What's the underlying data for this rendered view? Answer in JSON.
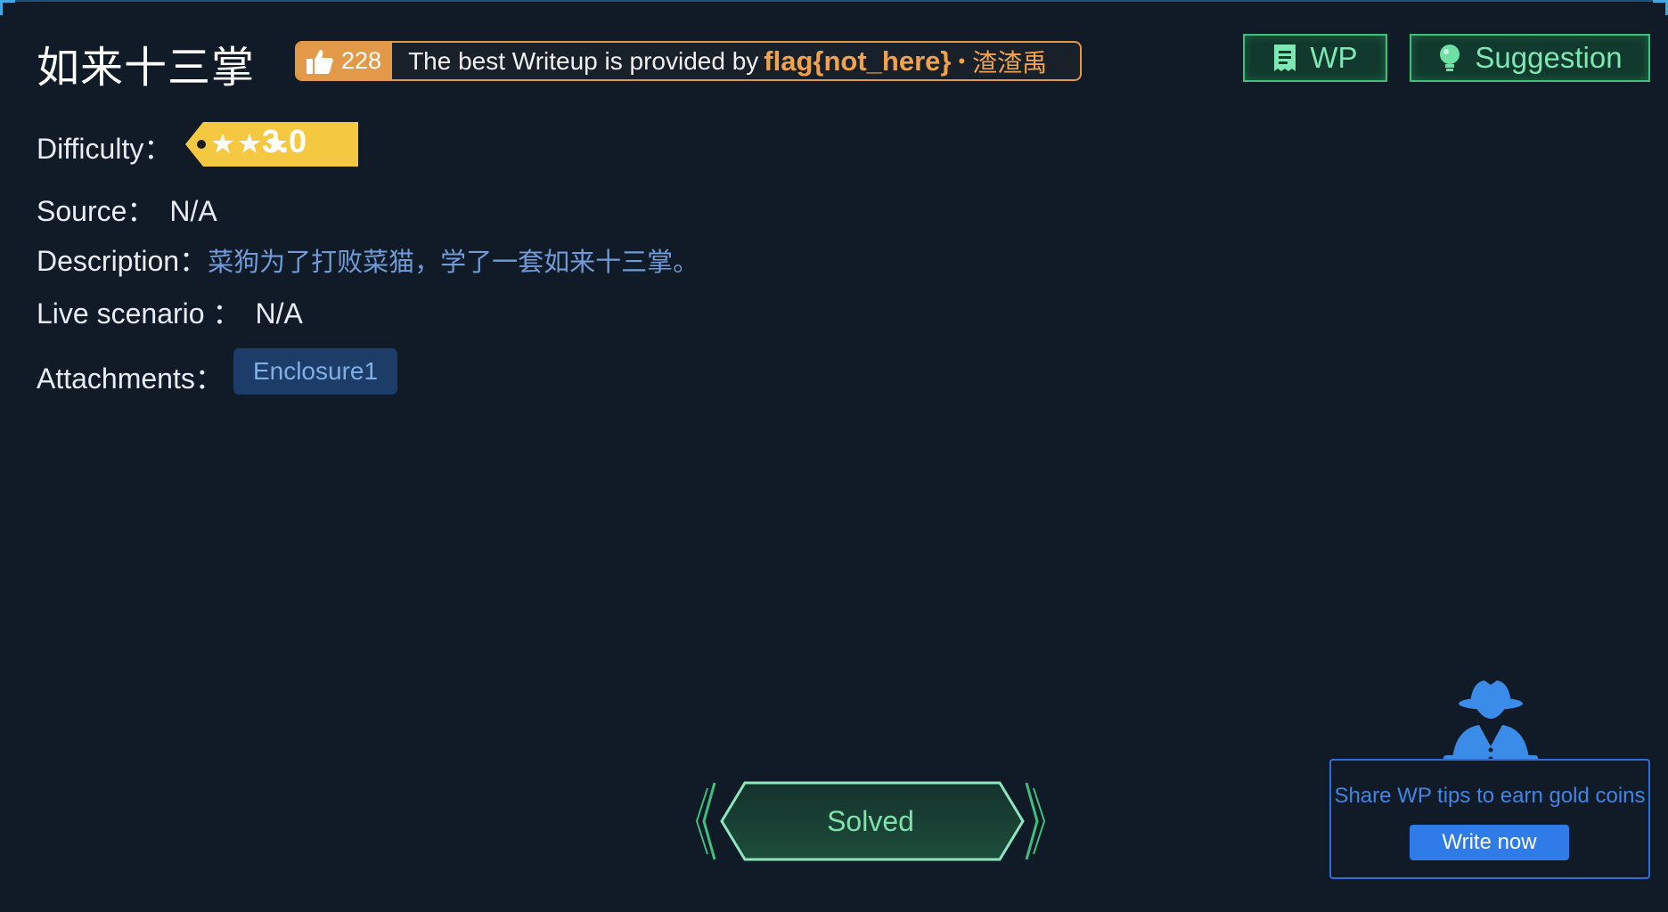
{
  "challenge": {
    "title": "如来十三掌"
  },
  "writeup_banner": {
    "likes": "228",
    "text": "The best Writeup is provided by",
    "provider": "flag{not_here}",
    "separator": "•",
    "provider_alt": "渣渣禹"
  },
  "header_buttons": {
    "wp_label": "WP",
    "suggestion_label": "Suggestion"
  },
  "details": {
    "difficulty_label": "Difficulty：",
    "difficulty_value": "3.0",
    "difficulty_stars": 3,
    "source_label": "Source：",
    "source_value": "N/A",
    "description_label": "Description：",
    "description_value": "菜狗为了打败菜猫，学了一套如来十三掌。",
    "live_label": "Live scenario ：",
    "live_value": "N/A",
    "attachments_label": "Attachments：",
    "attachment_name": "Enclosure1"
  },
  "status": {
    "solved_label": "Solved"
  },
  "promo": {
    "text": "Share WP tips to earn gold coins",
    "button_label": "Write now"
  },
  "colors": {
    "background": "#111a27",
    "accent_orange": "#e39a48",
    "accent_green": "#3fbf7a",
    "accent_blue": "#2f7be8",
    "difficulty_tag": "#f5c842"
  },
  "icons": [
    "thumbs-up-icon",
    "document-icon",
    "lightbulb-icon",
    "star-icon",
    "spy-icon"
  ]
}
